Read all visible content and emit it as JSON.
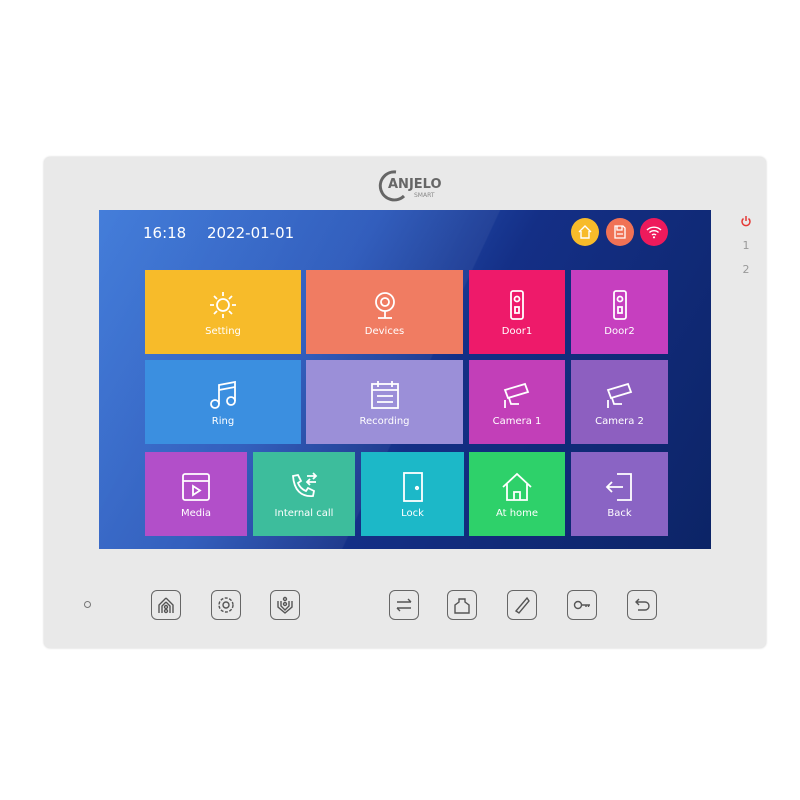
{
  "brand": {
    "name": "ANJELO",
    "sub": "SMART"
  },
  "status": {
    "time": "16:18",
    "date": "2022-01-01",
    "icons": [
      {
        "name": "home-icon",
        "color": "#f7bb2a"
      },
      {
        "name": "save-icon",
        "color": "#f07255"
      },
      {
        "name": "wifi-icon",
        "color": "#ee1a5c"
      }
    ]
  },
  "tiles": [
    {
      "label": "Setting",
      "icon": "gear-icon",
      "color": "#f7bb2a"
    },
    {
      "label": "Devices",
      "icon": "webcam-icon",
      "color": "#f07c62"
    },
    {
      "label": "Door1",
      "icon": "doorbell-icon",
      "color": "#ee1a6a"
    },
    {
      "label": "Door2",
      "icon": "doorbell-icon",
      "color": "#c63fbf"
    },
    {
      "label": "Ring",
      "icon": "music-note-icon",
      "color": "#3b8fe0"
    },
    {
      "label": "Recording",
      "icon": "calendar-icon",
      "color": "#9b8fd8"
    },
    {
      "label": "Camera 1",
      "icon": "cctv-icon",
      "color": "#c23fb8"
    },
    {
      "label": "Camera 2",
      "icon": "cctv-icon",
      "color": "#8d5fc0"
    },
    {
      "label": "Media",
      "icon": "video-icon",
      "color": "#b24fc9"
    },
    {
      "label": "Internal call",
      "icon": "phone-transfer-icon",
      "color": "#3dbd9c"
    },
    {
      "label": "Lock",
      "icon": "door-icon",
      "color": "#1cb8c8"
    },
    {
      "label": "At home",
      "icon": "house-icon",
      "color": "#2ed16a"
    },
    {
      "label": "Back",
      "icon": "exit-icon",
      "color": "#8a64c4"
    }
  ],
  "side": {
    "power_color": "#e53935",
    "one": "1",
    "two": "2"
  },
  "hardware_buttons": [
    "home-button",
    "settings-button",
    "monitor-button",
    "transfer-button",
    "intercom-button",
    "call-button",
    "unlock-button",
    "back-button"
  ]
}
